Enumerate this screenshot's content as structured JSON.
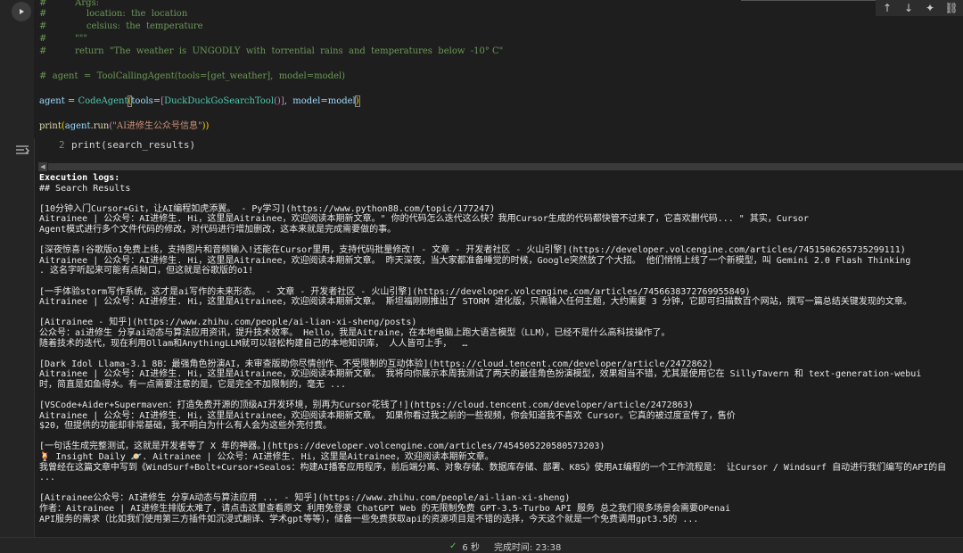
{
  "code_lines": [
    {
      "kind": "comment",
      "text": "#          Args:"
    },
    {
      "kind": "comment",
      "text": "#              location:  the  location"
    },
    {
      "kind": "comment",
      "text": "#              celsius:  the  temperature"
    },
    {
      "kind": "comment",
      "text": "#          \"\"\""
    },
    {
      "kind": "comment",
      "text": "#          return  \"The  weather  is  UNGODLY  with  torrential  rains  and  temperatures  below  -10° C\""
    },
    {
      "kind": "blank",
      "text": ""
    },
    {
      "kind": "comment",
      "text": "#  agent  =  ToolCallingAgent(tools=[get_weather],  model=model)"
    },
    {
      "kind": "blank",
      "text": ""
    },
    {
      "kind": "code_agent",
      "var": "agent",
      "op": " = ",
      "cls": "CodeAgent",
      "open": "(",
      "kw": "tools",
      "eq": "=",
      "lb": "[",
      "tool": "DuckDuckGoSearchTool",
      "call": "()",
      "rb": "]",
      "sep": ",  ",
      "kw2": "model",
      "eq2": "=",
      "val": "model",
      "close": ")"
    },
    {
      "kind": "blank",
      "text": ""
    },
    {
      "kind": "print",
      "fn": "print",
      "open": "(",
      "obj": "agent",
      "dot": ".",
      "meth": "run",
      "open2": "(",
      "str": "\"AI进修生公众号信息\"",
      "close": "))"
    }
  ],
  "partial_cell": {
    "line_number": "2",
    "code": "print(search_results)"
  },
  "toolbar": {
    "up": "↑",
    "down": "↓",
    "sparkle": "✦",
    "link": "⛓"
  },
  "output": {
    "heading1": "Execution logs:",
    "heading2": "## Search Results",
    "lines": [
      "",
      "[10分钟入门Cursor+Git，让AI编程如虎添翼。 - Py学习](https://www.python88.com/topic/177247)",
      "Aitrainee | 公众号：AI进修生. Hi，这里是Aitrainee，欢迎阅读本期新文章。\" 你的代码怎么迭代这么快？我用Cursor生成的代码都快管不过来了，它喜欢删代码... \" 其实，Cursor",
      "Agent模式进行多个文件代码的修改，对代码进行增加删改，这本来就是完成需要做的事。",
      "",
      "[深夜惊喜!谷歌版o1免费上线，支持图片和音频输入!还能在Cursor里用，支持代码批量修改! - 文章 - 开发者社区 - 火山引擎](https://developer.volcengine.com/articles/7451506265735299111)",
      "Aitrainee | 公众号：AI进修生. Hi，这里是Aitrainee，欢迎阅读本期新文章。 昨天深夜，当大家都准备睡觉的时候，Google突然放了个大招。 他们悄悄上线了一个新模型，叫 Gemini 2.0 Flash Thinking",
      ". 这名字听起来可能有点拗口，但这就是谷歌版的o1!",
      "",
      "[一手体验storm写作系统，这才是ai写作的未来形态。 - 文章 - 开发者社区 - 火山引擎](https://developer.volcengine.com/articles/7456638372769955849)",
      "Aitrainee | 公众号：AI进修生. Hi，这里是Aitrainee，欢迎阅读本期新文章。 斯坦福刚刚推出了 STORM 进化版，只需输入任何主题，大约需要 3 分钟，它即可扫描数百个网站，撰写一篇总结关键发现的文章。",
      "",
      "[Aitrainee - 知乎](https://www.zhihu.com/people/ai-lian-xi-sheng/posts)",
      "公众号：ai进修生 分享ai动态与算法应用资讯，提升技术效率。 Hello，我是Aitraine，在本地电脑上跑大语言模型（LLM），已经不是什么高科技操作了。",
      "随着技术的迭代，现在利用Ollam和AnythingLLM就可以轻松构建自己的本地知识库， 人人皆可上手，  …",
      "",
      "[Dark Idol Llama-3.1 8B：最强角色扮演AI，未审查版助你尽情创作、不受限制的互动体验](https://cloud.tencent.com/developer/article/2472862)",
      "Aitrainee | 公众号：AI进修生. Hi，这里是Aitrainee，欢迎阅读本期新文章。 我将向你展示本周我测试了两天的最佳角色扮演模型，效果相当不错，尤其是使用它在 SillyTavern 和 text-generation-webui",
      "时，简直是如鱼得水。有一点需要注意的是，它是完全不加限制的，毫无 ...",
      "",
      "[VSCode+Aider+Supermaven：打造免费开源的顶级AI开发环境，别再为Cursor花钱了!](https://cloud.tencent.com/developer/article/2472863)",
      "Aitrainee | 公众号：AI进修生. Hi，这里是Aitrainee，欢迎阅读本期新文章。 如果你看过我之前的一些视频，你会知道我不喜欢 Cursor。它真的被过度宣传了，售价",
      "$20，但提供的功能却非常基础，我不明白为什么有人会为这些外壳付费。",
      "",
      "[一句话生成完整测试，这就是开发者等了 X 年的神器。](https://developer.volcengine.com/articles/7454505220580573203)",
      "🍹 Insight Daily 🪐. Aitrainee | 公众号：AI进修生. Hi，这里是Aitrainee，欢迎阅读本期新文章。",
      "我曾经在这篇文章中写到《WindSurf+Bolt+Cursor+Sealos：构建AI播客应用程序，前后端分离、对象存储、数据库存储、部署、K8S》使用AI编程的一个工作流程是： 让Cursor / Windsurf 自动进行我们编写的API的自",
      "...",
      "",
      "[Aitrainee公众号：AI进修生 分享A动态与算法应用 ... - 知乎](https://www.zhihu.com/people/ai-lian-xi-sheng)",
      "作者：Aitrainee | AI进修生排版太难了，请点击这里查看原文 利用免登录 ChatGPT Web 的无限制免费 GPT-3.5-Turbo API 服务 总之我们很多场景会需要OPenai",
      "API服务的需求（比如我们使用第三方插件如沉浸式翻译、学术gpt等等），储备一些免费获取api的资源项目是不错的选择，今天这个就是一个免费调用gpt3.5的 ..."
    ]
  },
  "status": {
    "check": "✓",
    "duration": "6 秒",
    "completed": "完成时间: 23:38"
  }
}
